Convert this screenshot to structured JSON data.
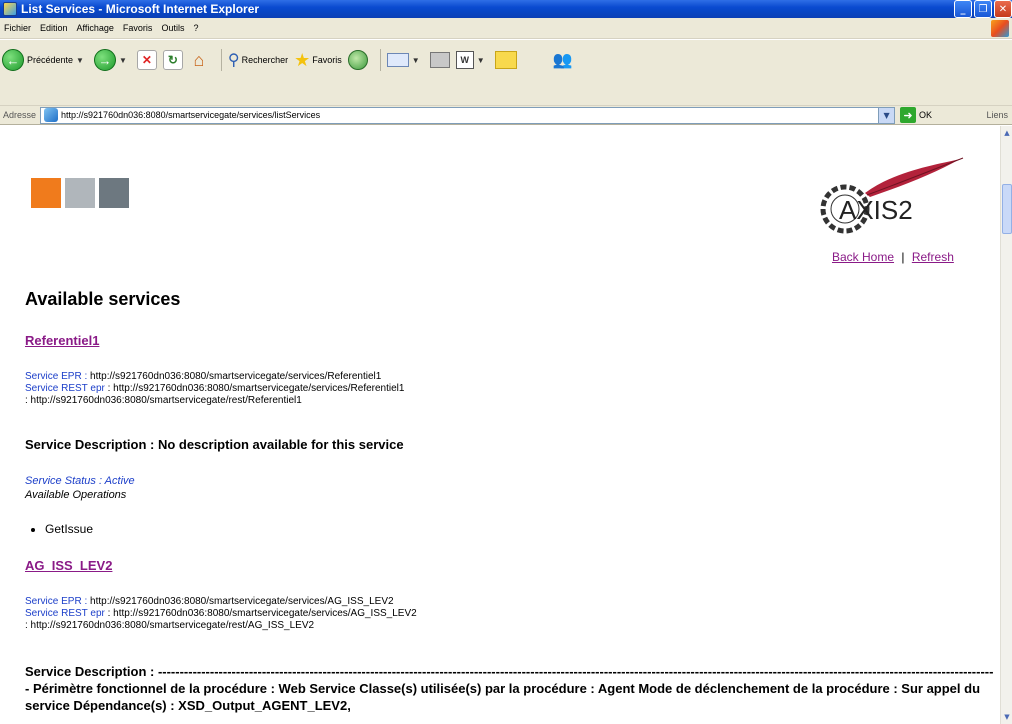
{
  "window": {
    "title": "List Services - Microsoft Internet Explorer"
  },
  "menu": {
    "items": [
      "Fichier",
      "Edition",
      "Affichage",
      "Favoris",
      "Outils",
      "?"
    ]
  },
  "toolbar": {
    "back_label": "Précédente",
    "search_label": "Rechercher",
    "favorites_label": "Favoris"
  },
  "address": {
    "label": "Adresse",
    "url": "http://s921760dn036:8080/smartservicegate/services/listServices",
    "go_label": "OK",
    "links_label": "Liens"
  },
  "page": {
    "logo_text": "AXIS2",
    "back_home": "Back Home",
    "separator": "|",
    "refresh": "Refresh",
    "heading": "Available services",
    "colors": {
      "sq1": "#f07b1c",
      "sq2": "#b0b6bb",
      "sq3": "#6d7880"
    },
    "services": [
      {
        "name": "Referentiel1",
        "epr_label": "Service EPR :",
        "epr_value": "http://s921760dn036:8080/smartservicegate/services/Referentiel1",
        "rest_label": "Service REST epr",
        "rest_value": ": http://s921760dn036:8080/smartservicegate/services/Referentiel1",
        "rest_value2": ": http://s921760dn036:8080/smartservicegate/rest/Referentiel1",
        "description": "Service Description : No description available for this service",
        "status": "Service Status : Active",
        "ops_label": "Available Operations",
        "operations": [
          "GetIssue"
        ]
      },
      {
        "name": "AG_ISS_LEV2",
        "epr_label": "Service EPR :",
        "epr_value": "http://s921760dn036:8080/smartservicegate/services/AG_ISS_LEV2",
        "rest_label": "Service REST epr",
        "rest_value": ": http://s921760dn036:8080/smartservicegate/services/AG_ISS_LEV2",
        "rest_value2": ": http://s921760dn036:8080/smartservicegate/rest/AG_ISS_LEV2",
        "description": "Service Description : -------------------------------------------------------------------------------------------------------------------------------------------------------------------------------------------------- Périmètre fonctionnel de la procédure : Web Service Classe(s) utilisée(s) par la procédure : Agent Mode de déclenchement de la procédure : Sur appel du service Dépendance(s) : XSD_Output_AGENT_LEV2,"
      }
    ]
  }
}
